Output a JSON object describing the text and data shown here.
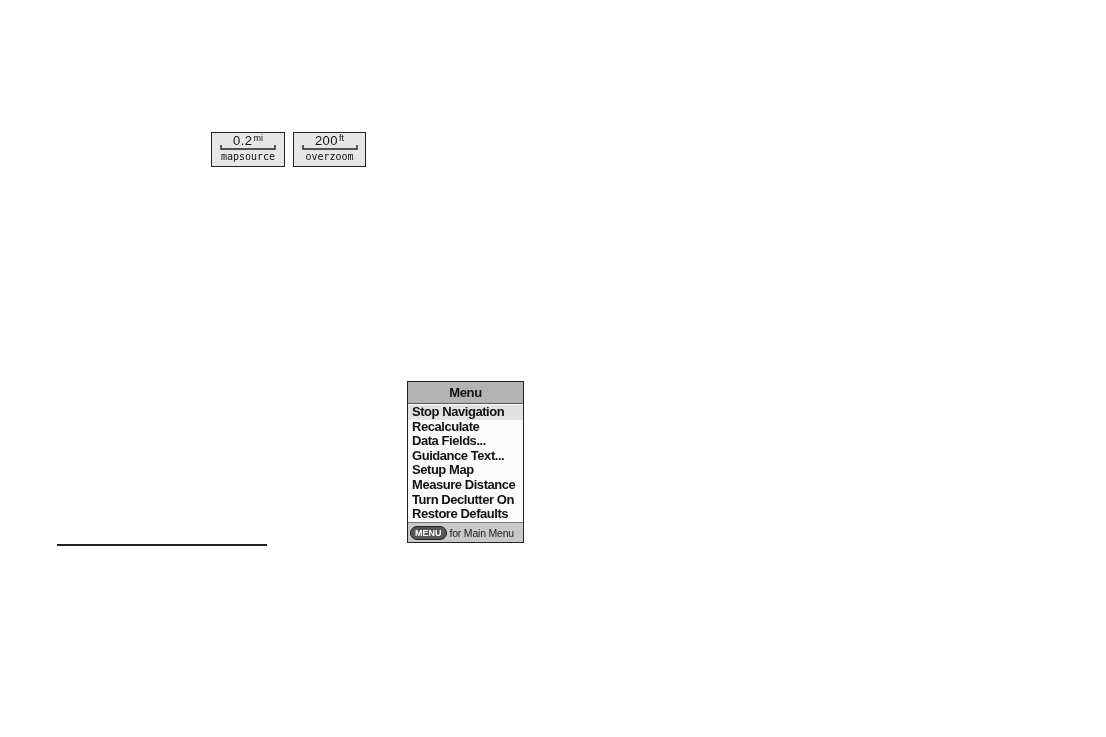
{
  "scale_examples": [
    {
      "value": "0.2",
      "unit": "mi",
      "caption": "mapsource"
    },
    {
      "value": "200",
      "unit": "ft",
      "caption": "overzoom"
    }
  ],
  "menu_screen": {
    "title": "Menu",
    "items": [
      {
        "label": "Stop Navigation",
        "selected": true
      },
      {
        "label": "Recalculate",
        "selected": false
      },
      {
        "label": "Data Fields...",
        "selected": false
      },
      {
        "label": "Guidance Text...",
        "selected": false
      },
      {
        "label": "Setup Map",
        "selected": false
      },
      {
        "label": "Measure Distance",
        "selected": false
      },
      {
        "label": "Turn Declutter On",
        "selected": false
      },
      {
        "label": "Restore Defaults",
        "selected": false
      }
    ],
    "footer": {
      "key": "MENU",
      "text": "for Main Menu"
    }
  }
}
